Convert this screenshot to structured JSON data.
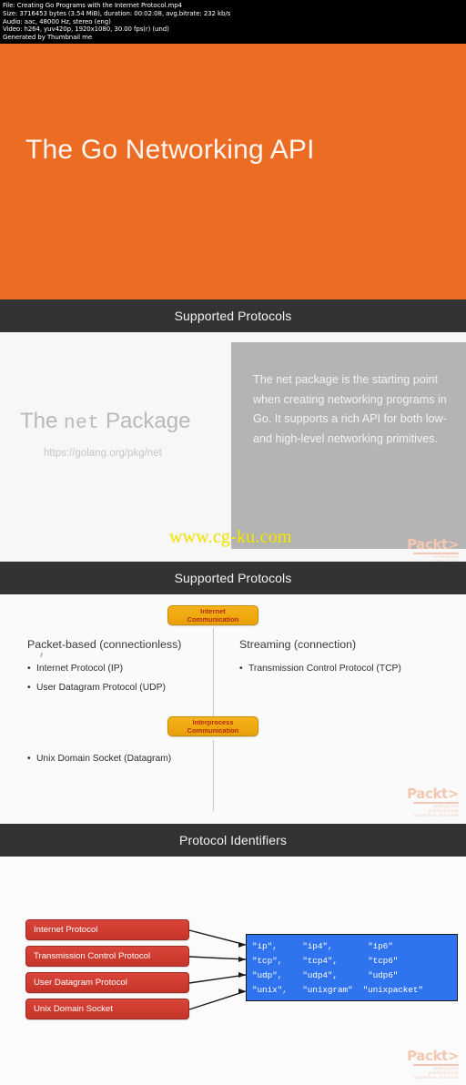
{
  "meta": {
    "lines": [
      "File: Creating Go Programs with the Internet Protocol.mp4",
      "Size: 3716453 bytes (3.54 MiB), duration: 00:02:08, avg.bitrate: 232 kb/s",
      "Audio: aac, 48000 Hz, stereo (eng)",
      "Video: h264, yuv420p, 1920x1080, 30.00 fps(r) (und)",
      "Generated by Thumbnail me"
    ]
  },
  "brand": {
    "word": "Packt>",
    "tagline": "enterprise professional expertise distilled"
  },
  "slide_title": {
    "heading": "The Go Networking API",
    "background": "#ec6c24"
  },
  "slide_net": {
    "bar_label": "Supported Protocols",
    "head_prefix": "The ",
    "head_mono": "net",
    "head_suffix": " Package",
    "url": "https://golang.org/pkg/net",
    "panel_text": "The net package is the starting point when creating networking programs in Go.  It supports a rich API for both low- and high-level networking primitives.",
    "watermark": "www.cg-ku.com"
  },
  "slide_protocols": {
    "bar_label": "Supported Protocols",
    "pill_top": {
      "line1": "Internet",
      "line2": "Communication"
    },
    "pill_bottom": {
      "line1": "Interprocess",
      "line2": "Communication"
    },
    "left_column": {
      "heading": "Packet-based (connectionless)",
      "items": [
        "Internet Protocol (IP)",
        "User Datagram Protocol (UDP)"
      ]
    },
    "right_column": {
      "heading": "Streaming (connection)",
      "items": [
        "Transmission Control Protocol (TCP)"
      ]
    },
    "ipc_items": [
      "Unix Domain Socket (Datagram)"
    ]
  },
  "slide_identifiers": {
    "bar_label": "Protocol Identifiers",
    "protocols": [
      "Internet Protocol",
      "Transmission Control Protocol",
      "User Datagram Protocol",
      "Unix Domain Socket"
    ],
    "code_lines": [
      "\"ip\",     \"ip4\",       \"ip6\"",
      "\"tcp\",    \"tcp4\",      \"tcp6\"",
      "\"udp\",    \"udp4\",      \"udp6\"",
      "\"unix\",   \"unixgram\"  \"unixpacket\""
    ],
    "code_background": "#2f73ef",
    "box_background": "#cf3a2f"
  }
}
